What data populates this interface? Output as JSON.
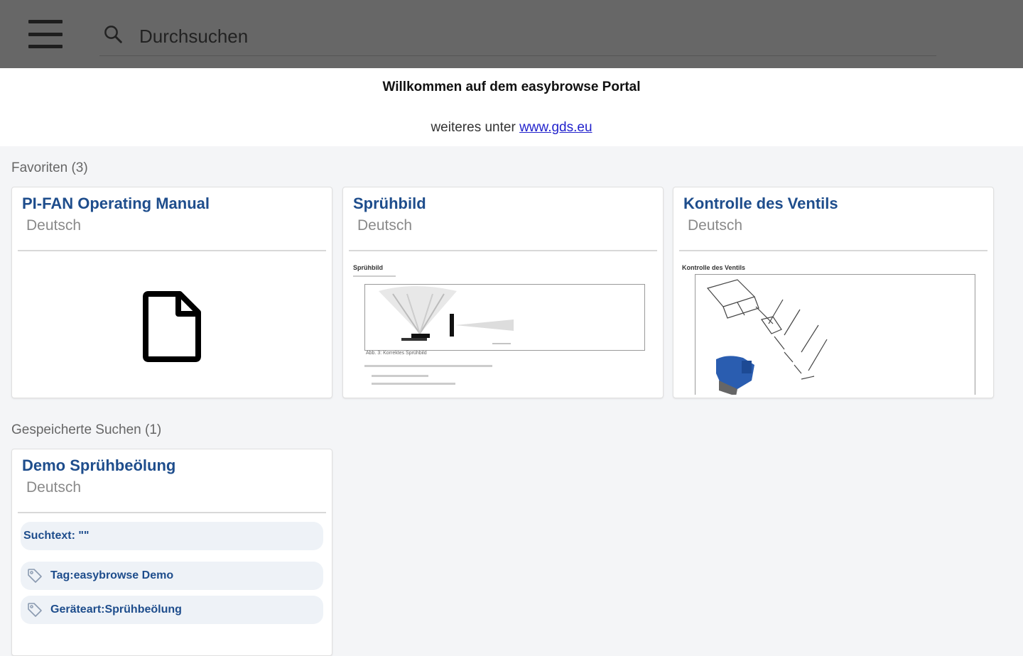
{
  "header": {
    "search_placeholder": "Durchsuchen"
  },
  "welcome": {
    "title": "Willkommen auf dem easybrowse Portal",
    "more_prefix": "weiteres unter",
    "link_text": "www.gds.eu"
  },
  "favorites": {
    "heading": "Favoriten (3)",
    "items": [
      {
        "title": "PI-FAN Operating Manual",
        "language": "Deutsch"
      },
      {
        "title": "Sprühbild",
        "language": "Deutsch",
        "thumb": {
          "heading": "Sprühbild",
          "caption": "Abb. 3: Korrektes Sprühbild"
        }
      },
      {
        "title": "Kontrolle des Ventils",
        "language": "Deutsch",
        "thumb": {
          "heading": "Kontrolle des Ventils"
        }
      }
    ]
  },
  "saved_searches": {
    "heading": "Gespeicherte Suchen (1)",
    "items": [
      {
        "title": "Demo Sprühbeölung",
        "language": "Deutsch",
        "chips": {
          "text": "Suchtext: \"\"",
          "tag1": "Tag:easybrowse Demo",
          "tag2": "Geräteart:Sprühbeölung"
        }
      }
    ]
  },
  "colors": {
    "topbar": "#676767",
    "link_blue": "#1e4d8c",
    "background": "#f4f5f7"
  }
}
